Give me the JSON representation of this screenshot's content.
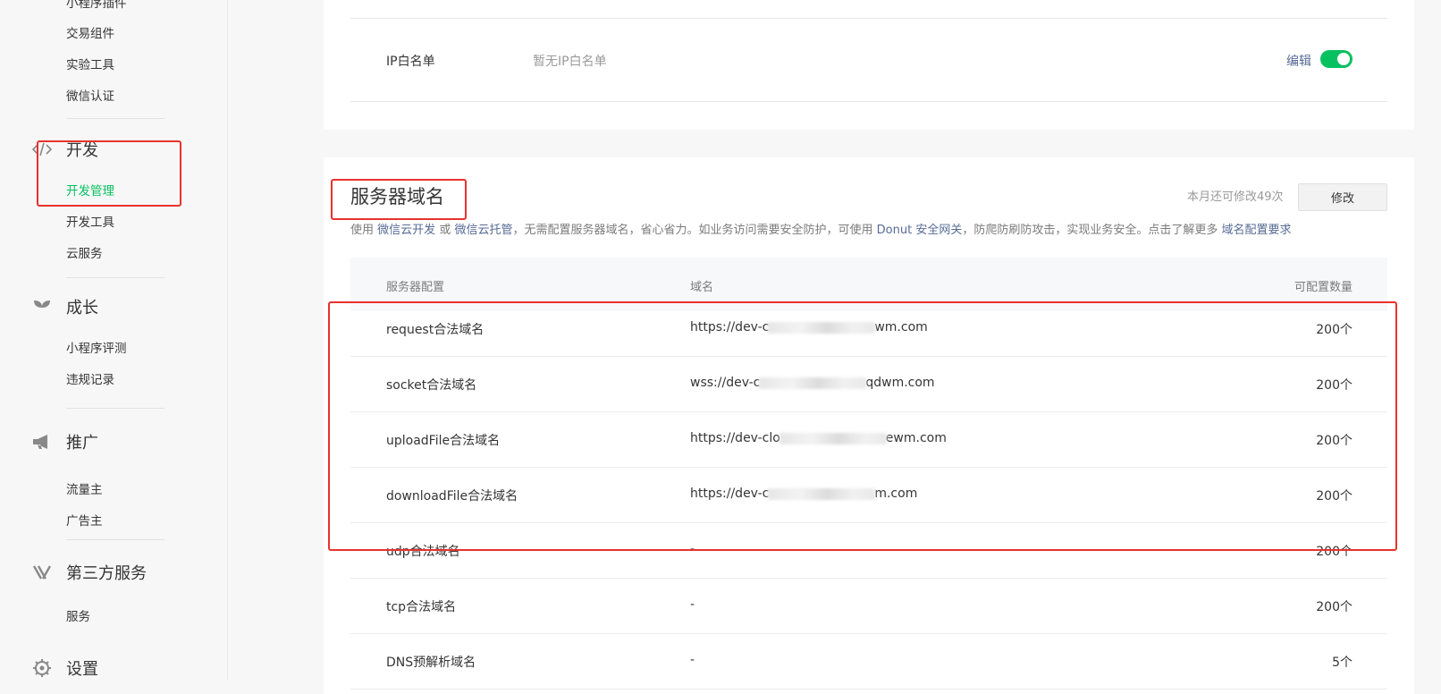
{
  "sidebar": {
    "top_items": [
      "小程序插件",
      "交易组件",
      "实验工具",
      "微信认证"
    ],
    "groups": [
      {
        "title": "开发",
        "icon": "code-icon",
        "items": [
          "开发管理",
          "开发工具",
          "云服务"
        ],
        "active": "开发管理"
      },
      {
        "title": "成长",
        "icon": "sprout-icon",
        "items": [
          "小程序评测",
          "违规记录"
        ]
      },
      {
        "title": "推广",
        "icon": "megaphone-icon",
        "items": [
          "流量主",
          "广告主"
        ]
      },
      {
        "title": "第三方服务",
        "icon": "third-party-icon",
        "items": [
          "服务"
        ]
      },
      {
        "title": "设置",
        "icon": "gear-icon",
        "items": []
      }
    ]
  },
  "ip_whitelist": {
    "label": "IP白名单",
    "value": "暂无IP白名单",
    "edit_label": "编辑",
    "toggle_on": true
  },
  "server_domain": {
    "title": "服务器域名",
    "quota_text": "本月还可修改49次",
    "modify_label": "修改",
    "desc": {
      "t1": "使用",
      "l1": "微信云开发",
      "t2": "或",
      "l2": "微信云托管",
      "t3": "，无需配置服务器域名，省心省力。如业务访问需要安全防护，可使用",
      "l3": "Donut 安全网关",
      "t4": "，防爬防刷防攻击，实现业务安全。点击了解更多",
      "l4": "域名配置要求"
    },
    "table": {
      "headers": [
        "服务器配置",
        "域名",
        "可配置数量"
      ],
      "rows": [
        {
          "name": "request合法域名",
          "domain_a": "https://dev-c",
          "domain_b": "wm.com",
          "count": "200个"
        },
        {
          "name": "socket合法域名",
          "domain_a": "wss://dev-c",
          "domain_b": "qdwm.com",
          "count": "200个"
        },
        {
          "name": "uploadFile合法域名",
          "domain_a": "https://dev-clo",
          "domain_b": "ewm.com",
          "count": "200个"
        },
        {
          "name": "downloadFile合法域名",
          "domain_a": "https://dev-c",
          "domain_b": "m.com",
          "count": "200个"
        },
        {
          "name": "udp合法域名",
          "domain": "-",
          "count": "200个"
        },
        {
          "name": "tcp合法域名",
          "domain": "-",
          "count": "200个"
        },
        {
          "name": "DNS预解析域名",
          "domain": "-",
          "count": "5个"
        }
      ]
    }
  },
  "colors": {
    "accent": "#07c160",
    "link": "#576b95",
    "highlight": "#e8322d"
  }
}
